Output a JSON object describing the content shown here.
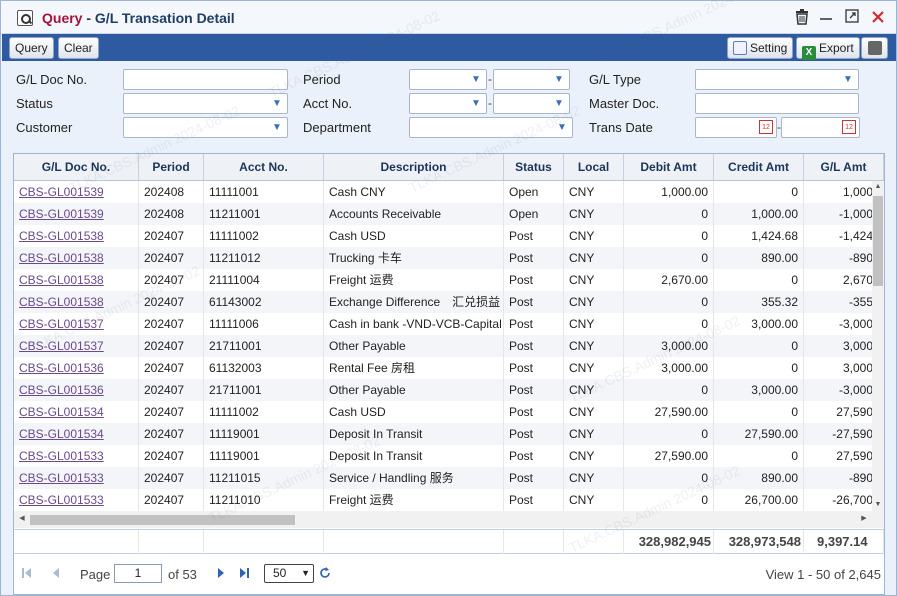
{
  "window": {
    "title_prefix": "Query",
    "title_separator": " - ",
    "title": "G/L Transation Detail"
  },
  "toolbar": {
    "query_label": "Query",
    "clear_label": "Clear",
    "setting_label": "Setting",
    "export_label": "Export"
  },
  "filters": {
    "gl_doc_no_label": "G/L Doc No.",
    "status_label": "Status",
    "customer_label": "Customer",
    "period_label": "Period",
    "acct_no_label": "Acct No.",
    "department_label": "Department",
    "gl_type_label": "G/L Type",
    "master_doc_label": "Master Doc.",
    "trans_date_label": "Trans Date",
    "range_separator": "-"
  },
  "grid": {
    "columns": [
      "G/L Doc No.",
      "Period",
      "Acct No.",
      "Description",
      "Status",
      "Local",
      "Debit Amt",
      "Credit Amt",
      "G/L Amt"
    ],
    "rows": [
      [
        "CBS-GL001539",
        "202408",
        "11111001",
        "Cash CNY",
        "Open",
        "CNY",
        "1,000.00",
        "0",
        "1,000"
      ],
      [
        "CBS-GL001539",
        "202408",
        "11211001",
        "Accounts Receivable",
        "Open",
        "CNY",
        "0",
        "1,000.00",
        "-1,000"
      ],
      [
        "CBS-GL001538",
        "202407",
        "11111002",
        "Cash USD",
        "Post",
        "CNY",
        "0",
        "1,424.68",
        "-1,424"
      ],
      [
        "CBS-GL001538",
        "202407",
        "11211012",
        "Trucking 卡车",
        "Post",
        "CNY",
        "0",
        "890.00",
        "-890"
      ],
      [
        "CBS-GL001538",
        "202407",
        "21111004",
        "Freight 运费",
        "Post",
        "CNY",
        "2,670.00",
        "0",
        "2,670"
      ],
      [
        "CBS-GL001538",
        "202407",
        "61143002",
        "Exchange Difference　汇兑损益",
        "Post",
        "CNY",
        "0",
        "355.32",
        "-355"
      ],
      [
        "CBS-GL001537",
        "202407",
        "11111006",
        "Cash in bank -VND-VCB-Capital",
        "Post",
        "CNY",
        "0",
        "3,000.00",
        "-3,000"
      ],
      [
        "CBS-GL001537",
        "202407",
        "21711001",
        "Other Payable",
        "Post",
        "CNY",
        "3,000.00",
        "0",
        "3,000"
      ],
      [
        "CBS-GL001536",
        "202407",
        "61132003",
        "Rental Fee 房租",
        "Post",
        "CNY",
        "3,000.00",
        "0",
        "3,000"
      ],
      [
        "CBS-GL001536",
        "202407",
        "21711001",
        "Other Payable",
        "Post",
        "CNY",
        "0",
        "3,000.00",
        "-3,000"
      ],
      [
        "CBS-GL001534",
        "202407",
        "11111002",
        "Cash USD",
        "Post",
        "CNY",
        "27,590.00",
        "0",
        "27,590"
      ],
      [
        "CBS-GL001534",
        "202407",
        "11119001",
        "Deposit In Transit",
        "Post",
        "CNY",
        "0",
        "27,590.00",
        "-27,590"
      ],
      [
        "CBS-GL001533",
        "202407",
        "11119001",
        "Deposit In Transit",
        "Post",
        "CNY",
        "27,590.00",
        "0",
        "27,590"
      ],
      [
        "CBS-GL001533",
        "202407",
        "11211015",
        "Service / Handling 服务",
        "Post",
        "CNY",
        "0",
        "890.00",
        "-890"
      ],
      [
        "CBS-GL001533",
        "202407",
        "11211010",
        "Freight 运费",
        "Post",
        "CNY",
        "0",
        "26,700.00",
        "-26,700"
      ]
    ],
    "totals": {
      "debit": "328,982,945",
      "credit": "328,973,548",
      "gl": "9,397.14"
    }
  },
  "pager": {
    "page_label": "Page",
    "page_value": "1",
    "of_label": "of 53",
    "page_size": "50",
    "view_text": "View 1 - 50 of 2,645"
  },
  "watermark_text": "TLKA.CBS.Admin 2024-08-02"
}
